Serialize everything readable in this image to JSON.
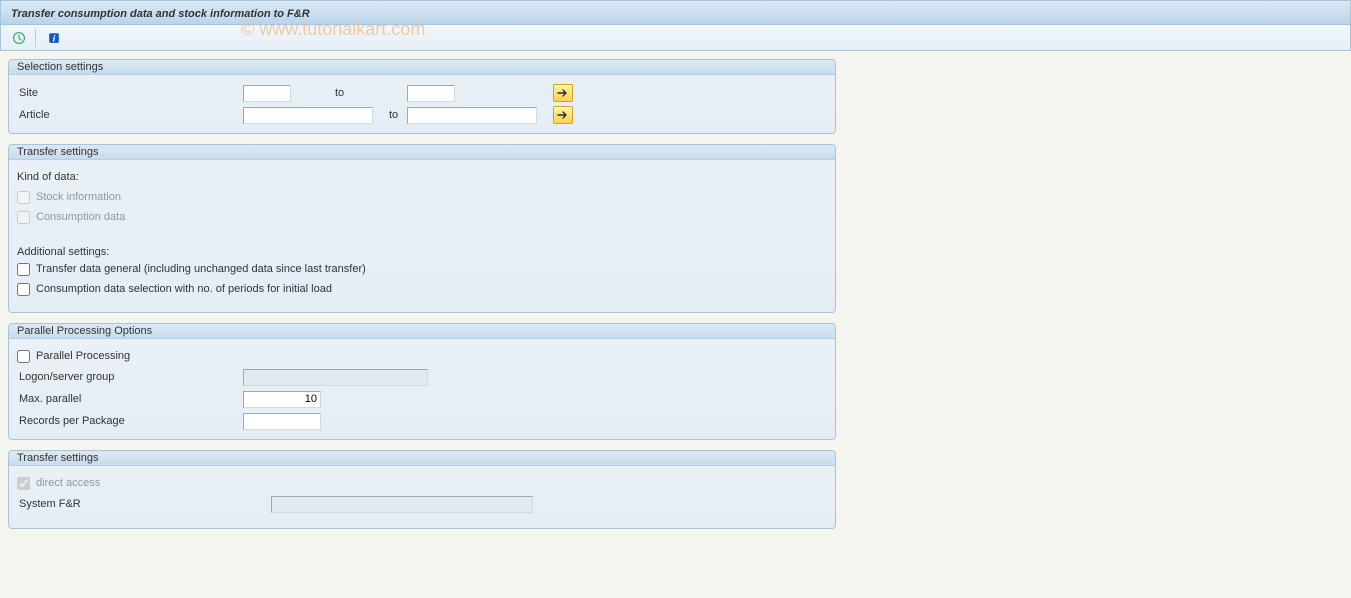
{
  "title": "Transfer consumption data and stock information to F&R",
  "watermark": "© www.tutorialkart.com",
  "toolbar": {
    "execute_icon": "execute",
    "info_icon": "info"
  },
  "selection": {
    "header": "Selection settings",
    "site_label": "Site",
    "site_from": "",
    "site_to": "",
    "article_label": "Article",
    "article_from": "",
    "article_to": "",
    "to_label": "to"
  },
  "transfer1": {
    "header": "Transfer settings",
    "kind_label": "Kind of data:",
    "stock_label": "Stock information",
    "consumption_label": "Consumption data",
    "additional_label": "Additional settings:",
    "general_label": "Transfer data general (including unchanged data since last transfer)",
    "cons_period_label": "Consumption data selection with no. of periods for initial load"
  },
  "parallel": {
    "header": "Parallel Processing Options",
    "parallel_label": "Parallel Processing",
    "logon_label": "Logon/server group",
    "logon_value": "",
    "max_label": "Max. parallel",
    "max_value": "10",
    "records_label": "Records per Package",
    "records_value": ""
  },
  "transfer2": {
    "header": "Transfer settings",
    "direct_label": "direct access",
    "system_label": "System F&R",
    "system_value": ""
  }
}
